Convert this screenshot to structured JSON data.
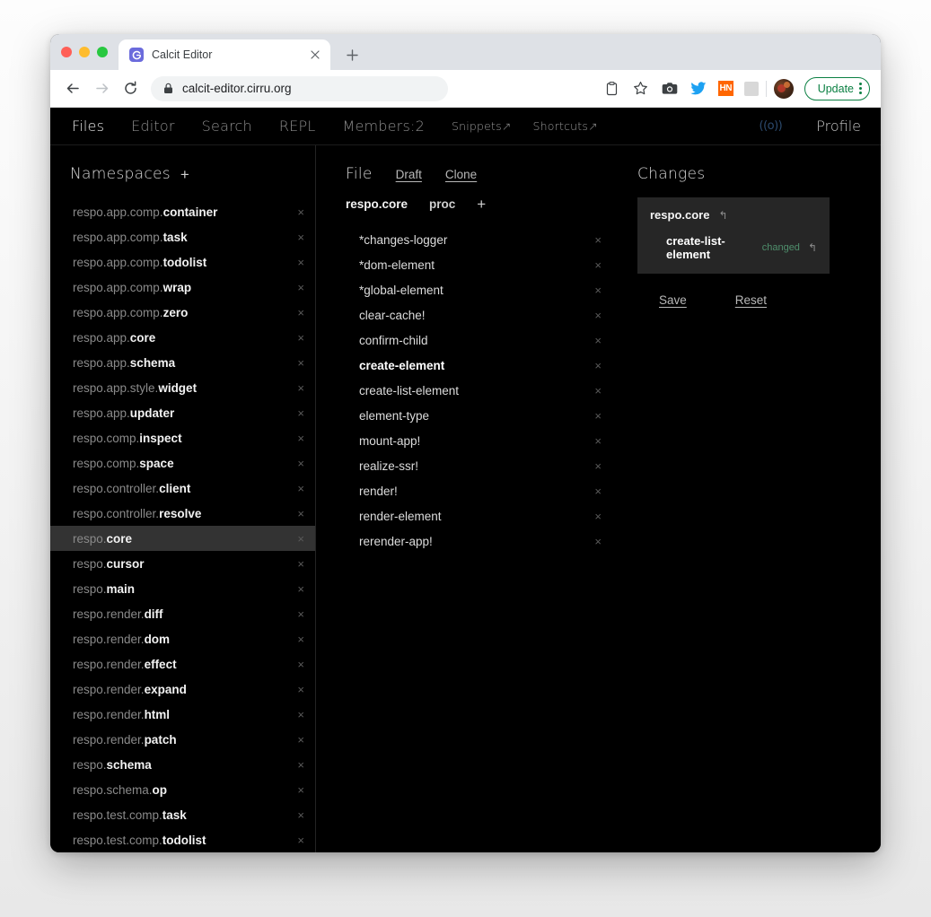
{
  "browser": {
    "tab": {
      "title": "Calcit Editor",
      "favicon": "calcit-favicon",
      "close": "×"
    },
    "new_tab": "+",
    "omnibox": {
      "url": "calcit-editor.cirru.org",
      "lock": "lock-icon"
    },
    "extensions": [
      {
        "name": "clipboard-icon"
      },
      {
        "name": "bookmark-star-icon"
      },
      {
        "name": "camera-icon"
      },
      {
        "name": "twitter-icon"
      },
      {
        "name": "hacker-news-icon",
        "label": "HN"
      },
      {
        "name": "disabled-extension-icon"
      }
    ],
    "update_button": "Update",
    "menu": "kebab-menu-icon"
  },
  "app": {
    "nav": {
      "items": [
        {
          "label": "Files",
          "active": true
        },
        {
          "label": "Editor",
          "active": false
        },
        {
          "label": "Search",
          "active": false
        },
        {
          "label": "REPL",
          "active": false
        },
        {
          "label": "Members:2",
          "active": false
        }
      ],
      "links": [
        {
          "label": "Snippets↗"
        },
        {
          "label": "Shortcuts↗"
        }
      ],
      "connection_icon": "((o))",
      "profile": "Profile"
    },
    "namespaces": {
      "title": "Namespaces",
      "add": "+",
      "items": [
        {
          "prefix": "respo.app.comp.",
          "leaf": "container",
          "selected": false
        },
        {
          "prefix": "respo.app.comp.",
          "leaf": "task",
          "selected": false
        },
        {
          "prefix": "respo.app.comp.",
          "leaf": "todolist",
          "selected": false
        },
        {
          "prefix": "respo.app.comp.",
          "leaf": "wrap",
          "selected": false
        },
        {
          "prefix": "respo.app.comp.",
          "leaf": "zero",
          "selected": false
        },
        {
          "prefix": "respo.app.",
          "leaf": "core",
          "selected": false
        },
        {
          "prefix": "respo.app.",
          "leaf": "schema",
          "selected": false
        },
        {
          "prefix": "respo.app.style.",
          "leaf": "widget",
          "selected": false
        },
        {
          "prefix": "respo.app.",
          "leaf": "updater",
          "selected": false
        },
        {
          "prefix": "respo.comp.",
          "leaf": "inspect",
          "selected": false
        },
        {
          "prefix": "respo.comp.",
          "leaf": "space",
          "selected": false
        },
        {
          "prefix": "respo.controller.",
          "leaf": "client",
          "selected": false
        },
        {
          "prefix": "respo.controller.",
          "leaf": "resolve",
          "selected": false
        },
        {
          "prefix": "respo.",
          "leaf": "core",
          "selected": true
        },
        {
          "prefix": "respo.",
          "leaf": "cursor",
          "selected": false
        },
        {
          "prefix": "respo.",
          "leaf": "main",
          "selected": false
        },
        {
          "prefix": "respo.render.",
          "leaf": "diff",
          "selected": false
        },
        {
          "prefix": "respo.render.",
          "leaf": "dom",
          "selected": false
        },
        {
          "prefix": "respo.render.",
          "leaf": "effect",
          "selected": false
        },
        {
          "prefix": "respo.render.",
          "leaf": "expand",
          "selected": false
        },
        {
          "prefix": "respo.render.",
          "leaf": "html",
          "selected": false
        },
        {
          "prefix": "respo.render.",
          "leaf": "patch",
          "selected": false
        },
        {
          "prefix": "respo.",
          "leaf": "schema",
          "selected": false
        },
        {
          "prefix": "respo.schema.",
          "leaf": "op",
          "selected": false
        },
        {
          "prefix": "respo.test.comp.",
          "leaf": "task",
          "selected": false
        },
        {
          "prefix": "respo.test.comp.",
          "leaf": "todolist",
          "selected": false
        }
      ],
      "remove_icon": "×"
    },
    "file": {
      "title": "File",
      "actions": [
        {
          "label": "Draft"
        },
        {
          "label": "Clone"
        }
      ],
      "tabs": [
        {
          "label": "respo.core",
          "active": true
        },
        {
          "label": "proc",
          "active": false
        }
      ],
      "add": "+",
      "definitions": [
        {
          "label": "*changes-logger",
          "highlighted": false
        },
        {
          "label": "*dom-element",
          "highlighted": false
        },
        {
          "label": "*global-element",
          "highlighted": false
        },
        {
          "label": "clear-cache!",
          "highlighted": false
        },
        {
          "label": "confirm-child",
          "highlighted": false
        },
        {
          "label": "create-element",
          "highlighted": true
        },
        {
          "label": "create-list-element",
          "highlighted": false
        },
        {
          "label": "element-type",
          "highlighted": false
        },
        {
          "label": "mount-app!",
          "highlighted": false
        },
        {
          "label": "realize-ssr!",
          "highlighted": false
        },
        {
          "label": "render!",
          "highlighted": false
        },
        {
          "label": "render-element",
          "highlighted": false
        },
        {
          "label": "rerender-app!",
          "highlighted": false
        }
      ],
      "remove_icon": "×"
    },
    "changes": {
      "title": "Changes",
      "namespace": "respo.core",
      "undo_icon": "↰",
      "entries": [
        {
          "label": "create-list-element",
          "status": "changed"
        }
      ],
      "save": "Save",
      "reset": "Reset"
    }
  },
  "colors": {
    "app_bg": "#000000",
    "selected_row": "#333333",
    "card_bg": "#262626",
    "changed_green": "#4f8f6c",
    "update_green": "#0b8043",
    "hn_orange": "#ff6600",
    "favicon_purple": "#6b6bdc",
    "connection_blue": "#2c4a6e"
  }
}
